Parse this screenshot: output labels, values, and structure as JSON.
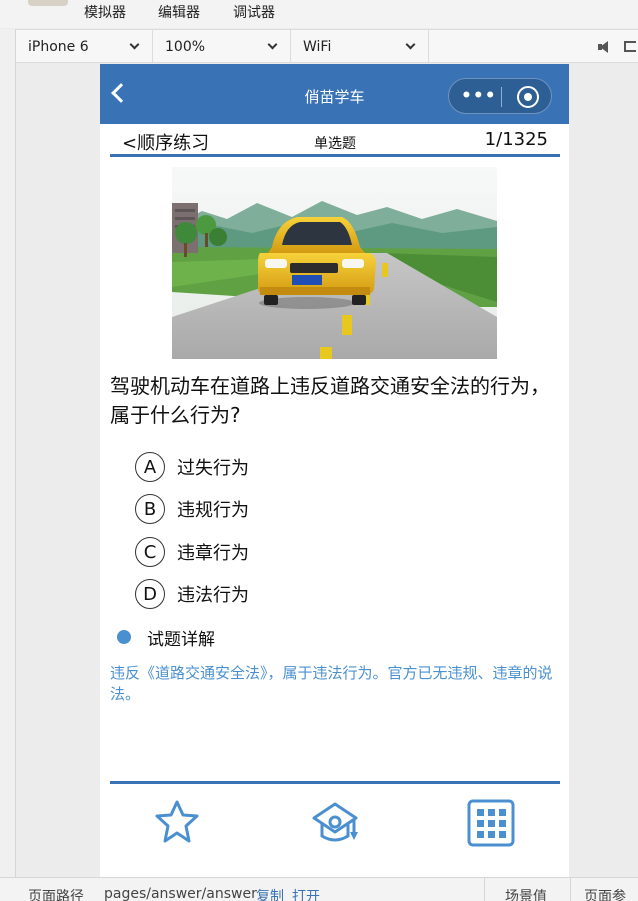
{
  "toolbar": {
    "items": [
      "模拟器",
      "编辑器",
      "调试器"
    ]
  },
  "device_bar": {
    "device": "iPhone 6",
    "zoom": "100%",
    "network": "WiFi"
  },
  "nav": {
    "title": "俏苗学车"
  },
  "subheader": {
    "mode": "<顺序练习",
    "question_type": "单选题",
    "progress": "1/1325"
  },
  "question": {
    "text": "驾驶机动车在道路上违反道路交通安全法的行为，属于什么行为?"
  },
  "options": [
    {
      "letter": "A",
      "text": "过失行为"
    },
    {
      "letter": "B",
      "text": "违规行为"
    },
    {
      "letter": "C",
      "text": "违章行为"
    },
    {
      "letter": "D",
      "text": "违法行为"
    }
  ],
  "detail": {
    "label": "试题详解",
    "explanation": "违反《道路交通安全法》，属于违法行为。官方已无违规、违章的说法。"
  },
  "tabbar": {
    "icons": [
      "star-icon",
      "graduation-cap-icon",
      "grid-icon"
    ]
  },
  "statusbar": {
    "path_label": "页面路径",
    "path": "pages/answer/answer",
    "copy": "复制",
    "open": "打开",
    "scene_label": "场景值",
    "params_label": "页面参数"
  },
  "colors": {
    "accent": "#3a73b5",
    "link": "#4a90d0"
  }
}
